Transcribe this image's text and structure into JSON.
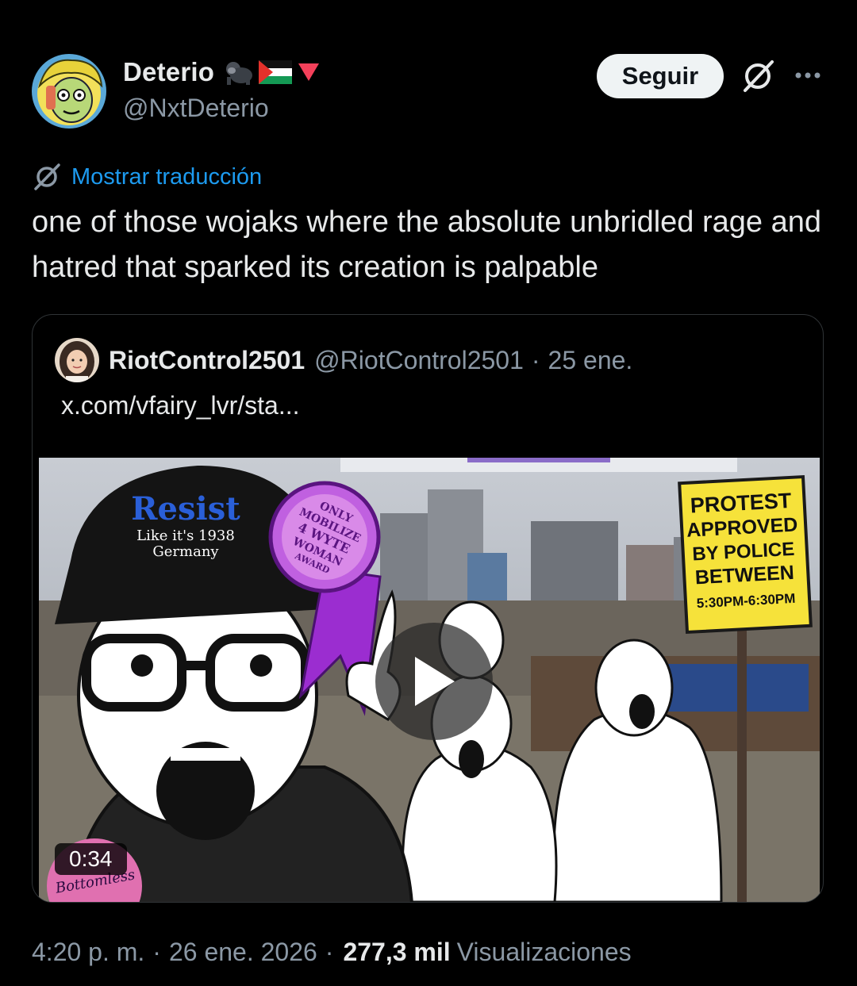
{
  "author": {
    "display_name": "Deterio",
    "handle": "@NxtDeterio",
    "name_emojis": [
      "gorilla-icon",
      "palestine-flag-icon",
      "red-triangle-icon"
    ]
  },
  "actions": {
    "follow_label": "Seguir",
    "grok_icon": "grok-icon",
    "more_icon": "more-icon"
  },
  "translation": {
    "label": "Mostrar traducción"
  },
  "tweet": {
    "text": "one of those wojaks where the absolute unbridled rage and hatred that sparked its creation is palpable"
  },
  "quoted": {
    "display_name": "RiotControl2501",
    "handle": "@RiotControl2501",
    "separator": "·",
    "date": "25 ene.",
    "text": "x.com/vfairy_lvr/sta...",
    "media": {
      "type": "video",
      "duration": "0:34",
      "cap_title": "Resist",
      "cap_subtitle_1": "Like it's 1938",
      "cap_subtitle_2": "Germany",
      "ribbon_lines": [
        "ONLY",
        "MOBILIZE",
        "4 WYTE",
        "WOMAN",
        "AWARD"
      ],
      "sign_lines": [
        "PROTEST",
        "APPROVED",
        "BY POLICE",
        "BETWEEN",
        "5:30PM-6:30PM"
      ],
      "pin_text": "Bottomless"
    }
  },
  "footer": {
    "time": "4:20 p. m.",
    "sep1": "·",
    "date": "26 ene. 2026",
    "sep2": "·",
    "views_count": "277,3 mil",
    "views_label": "Visualizaciones"
  },
  "colors": {
    "background": "#000000",
    "text": "#e7e9ea",
    "secondary": "#8b98a5",
    "link": "#1d9bf0",
    "border": "#2f3336",
    "follow_bg": "#eff3f4"
  }
}
